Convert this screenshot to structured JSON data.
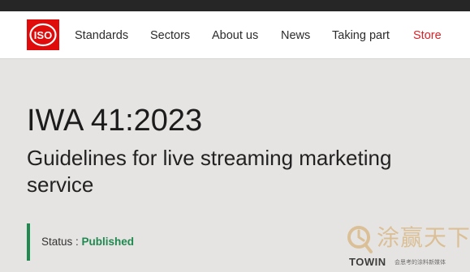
{
  "brand": {
    "logo_text": "ISO",
    "logo_color": "#e00b0b"
  },
  "nav": {
    "items": [
      {
        "label": "Standards"
      },
      {
        "label": "Sectors"
      },
      {
        "label": "About us"
      },
      {
        "label": "News"
      },
      {
        "label": "Taking part"
      },
      {
        "label": "Store"
      }
    ],
    "store_color": "#d8232a"
  },
  "document": {
    "code": "IWA 41:2023",
    "title": "Guidelines for live streaming marketing service"
  },
  "status": {
    "label": "Status : ",
    "value": "Published",
    "color": "#1e8a4f"
  },
  "watermark": {
    "brand_cn": "涂赢天下",
    "brand_en": "TOWIN",
    "tagline": "会思考的涂料新媒体"
  },
  "colors": {
    "top_strip": "#262626",
    "page_background": "#e6e4e2"
  }
}
